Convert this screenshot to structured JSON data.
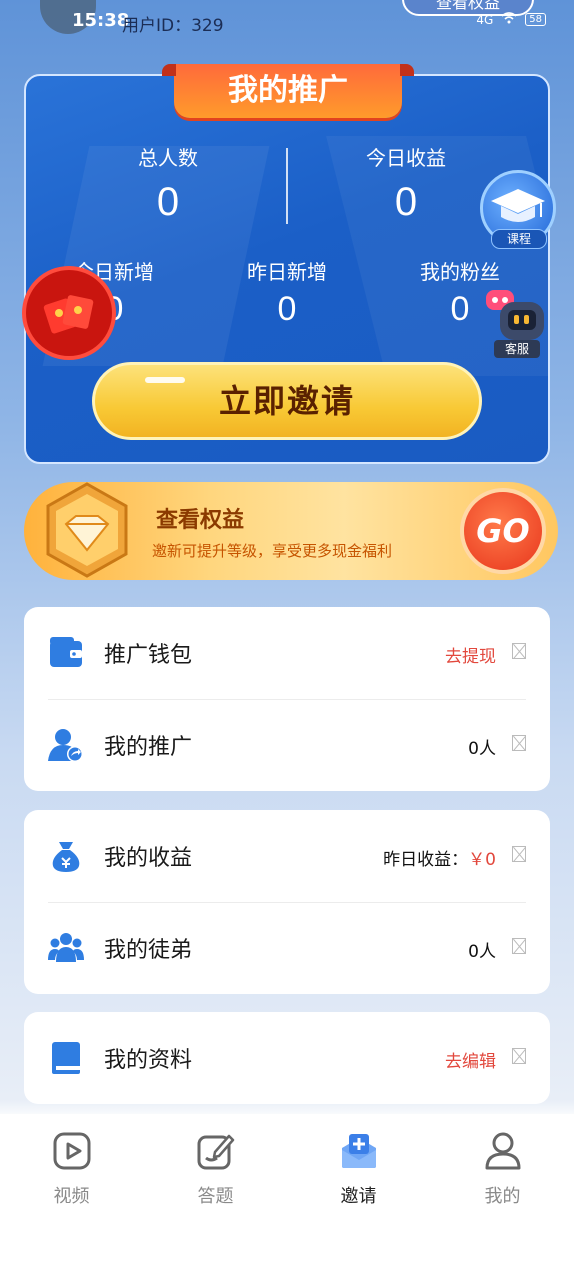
{
  "status_bar": {
    "time": "15:38",
    "network": "4G",
    "battery": "58"
  },
  "header": {
    "user_id": "用户ID：329",
    "rights_button": "查看权益"
  },
  "promo": {
    "title": "我的推广",
    "stats": [
      {
        "label": "总人数",
        "value": "0"
      },
      {
        "label": "今日收益",
        "value": "0"
      },
      {
        "label": "今日新增",
        "value": "0"
      },
      {
        "label": "昨日新增",
        "value": "0"
      },
      {
        "label": "我的粉丝",
        "value": "0"
      }
    ],
    "invite_button": "立即邀请"
  },
  "floating": {
    "course_label": "课程",
    "service_label": "客服"
  },
  "rights_banner": {
    "title": "查看权益",
    "subtitle": "邀新可提升等级，享受更多现金福利",
    "go": "GO"
  },
  "menu": {
    "wallet": {
      "label": "推广钱包",
      "action": "去提现"
    },
    "my_promo": {
      "label": "我的推广",
      "value": "0人"
    },
    "earnings": {
      "label": "我的收益",
      "value_label": "昨日收益：",
      "value": "￥0"
    },
    "disciples": {
      "label": "我的徒弟",
      "value": "0人"
    },
    "profile": {
      "label": "我的资料",
      "action": "去编辑"
    }
  },
  "tabs": [
    {
      "label": "视频",
      "icon": "video-icon"
    },
    {
      "label": "答题",
      "icon": "quiz-icon"
    },
    {
      "label": "邀请",
      "icon": "invite-icon"
    },
    {
      "label": "我的",
      "icon": "profile-icon"
    }
  ],
  "colors": {
    "primary_blue": "#1b5fc7",
    "accent_red": "#e2483d",
    "gold": "#f8c935"
  }
}
